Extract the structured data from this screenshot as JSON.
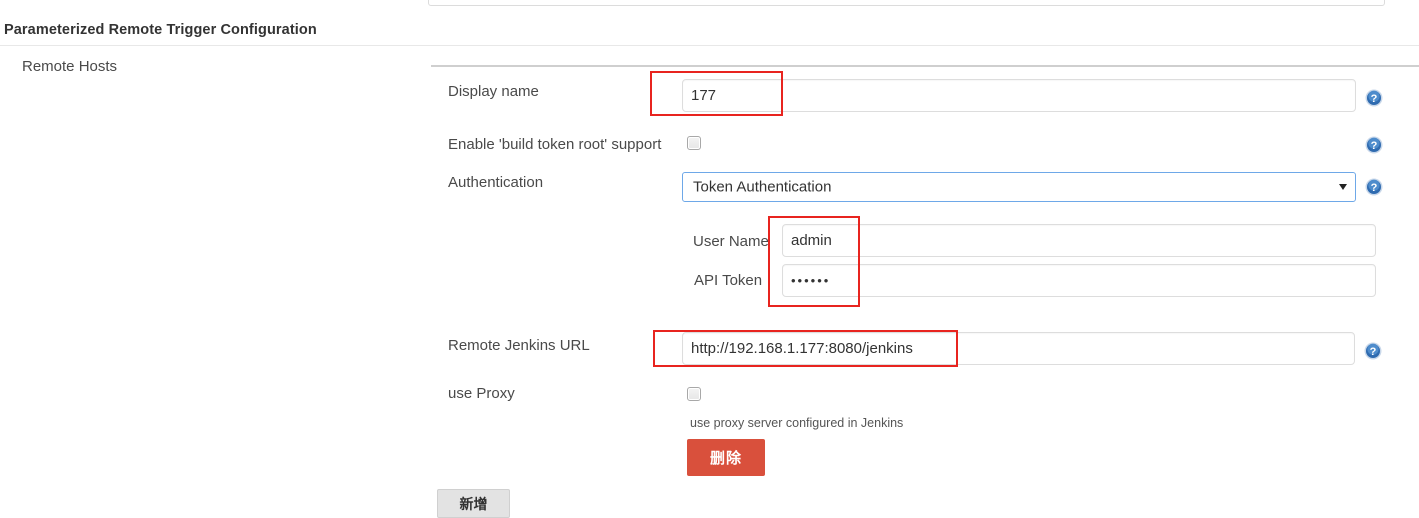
{
  "page": {
    "section_title": "Parameterized Remote Trigger Configuration",
    "group_label": "Remote Hosts"
  },
  "colors": {
    "annotation": "#e8241f",
    "delete_button": "#d9503c",
    "add_button": "#e3e3e3",
    "select_border": "#6ea8e8",
    "help_icon": "#2f6bb0"
  },
  "fields": {
    "display_name": {
      "label": "Display name",
      "value": "177",
      "placeholder": "",
      "help_icon": "help-icon"
    },
    "build_token_root": {
      "label": "Enable 'build token root' support",
      "checked": false,
      "help_icon": "help-icon"
    },
    "authentication": {
      "label": "Authentication",
      "selected": "Token Authentication",
      "options": [
        "Token Authentication"
      ],
      "arrow_icon": "chevron-down-icon",
      "help_icon": "help-icon"
    },
    "user_name": {
      "label": "User Name",
      "value": "admin",
      "placeholder": ""
    },
    "api_token": {
      "label": "API Token",
      "value": "••••••",
      "placeholder": ""
    },
    "remote_jenkins_url": {
      "label": "Remote Jenkins URL",
      "value": "http://192.168.1.177:8080/jenkins",
      "placeholder": "",
      "help_icon": "help-icon"
    },
    "use_proxy": {
      "label": "use Proxy",
      "checked": false,
      "hint": "use proxy server configured in Jenkins"
    }
  },
  "buttons": {
    "delete": "删除",
    "add": "新增"
  }
}
